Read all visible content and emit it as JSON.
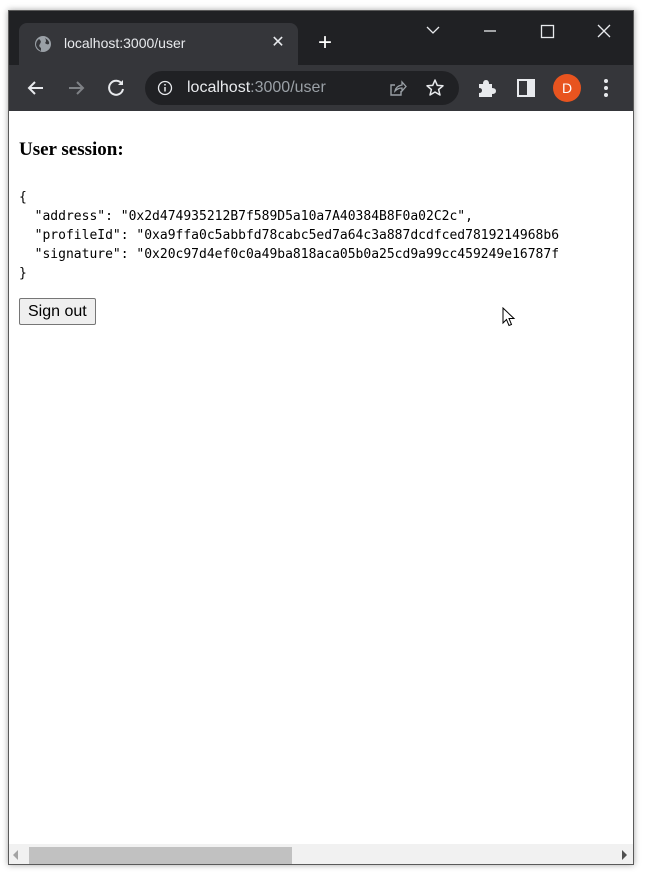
{
  "browser": {
    "tab_title": "localhost:3000/user",
    "tab_close_label": "✕",
    "new_tab_label": "+",
    "url_host": "localhost",
    "url_rest": ":3000/user",
    "profile_initial": "D",
    "profile_color": "#e8541f",
    "window_controls": {
      "tab_search": "⌄",
      "minimize": "—",
      "maximize": "☐",
      "close": "✕"
    },
    "icons": [
      "globe-icon",
      "back-icon",
      "forward-icon",
      "reload-icon",
      "info-icon",
      "share-icon",
      "star-icon",
      "puzzle-icon",
      "side-panel-icon",
      "kebab-menu-icon"
    ]
  },
  "page": {
    "heading": "User session:",
    "session_json": "{\n  \"address\": \"0x2d474935212B7f589D5a10a7A40384B8F0a02C2c\",\n  \"profileId\": \"0xa9ffa0c5abbfd78cabc5ed7a64c3a887dcdfced7819214968b6\n  \"signature\": \"0x20c97d4ef0c0a49ba818aca05b0a25cd9a99cc459249e16787f\n}",
    "session": {
      "address": "0x2d474935212B7f589D5a10a7A40384B8F0a02C2c",
      "profileId": "0xa9ffa0c5abbfd78cabc5ed7a64c3a887dcdfced7819214968b6",
      "signature": "0x20c97d4ef0c0a49ba818aca05b0a25cd9a99cc459249e16787f"
    },
    "sign_out_label": "Sign out"
  },
  "scrollbar": {
    "horizontal_position_fraction": 0.0,
    "visible_fraction": 0.45
  }
}
